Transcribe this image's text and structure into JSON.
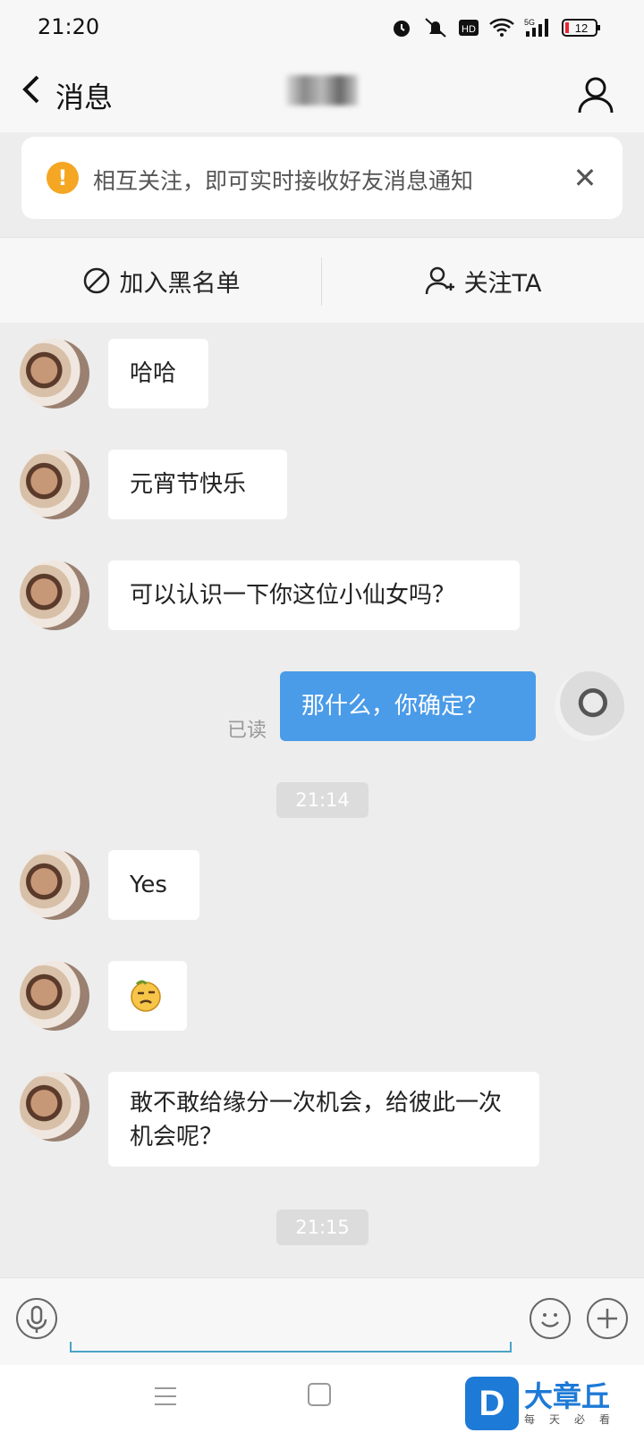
{
  "status_bar": {
    "time": "21:20",
    "battery": "12",
    "network": "5G"
  },
  "header": {
    "back_label": "消息",
    "contact_name": ""
  },
  "notice": {
    "text": "相互关注，即可实时接收好友消息通知",
    "icon": "!",
    "close": "✕"
  },
  "actions": {
    "block_label": "加入黑名单",
    "follow_label": "关注TA"
  },
  "messages": [
    {
      "from": "other",
      "text": "哈哈"
    },
    {
      "from": "other",
      "text": "元宵节快乐"
    },
    {
      "from": "other",
      "text": "可以认识一下你这位小仙女吗？"
    },
    {
      "from": "self",
      "text": "那什么，你确定？",
      "status": "已读"
    },
    {
      "type": "time",
      "text": "21:14"
    },
    {
      "from": "other",
      "text": "Yes"
    },
    {
      "from": "other",
      "emoji": "thinking-emoji"
    },
    {
      "from": "other",
      "text": "敢不敢给缘分一次机会，给彼此一次机会呢？"
    },
    {
      "type": "time",
      "text": "21:15"
    }
  ],
  "watermark": {
    "logo": "D",
    "text": "大章丘",
    "sub": "每天必看"
  },
  "colors": {
    "sent_bubble": "#4a9be8",
    "accent": "#f5a623",
    "background": "#ededed"
  }
}
